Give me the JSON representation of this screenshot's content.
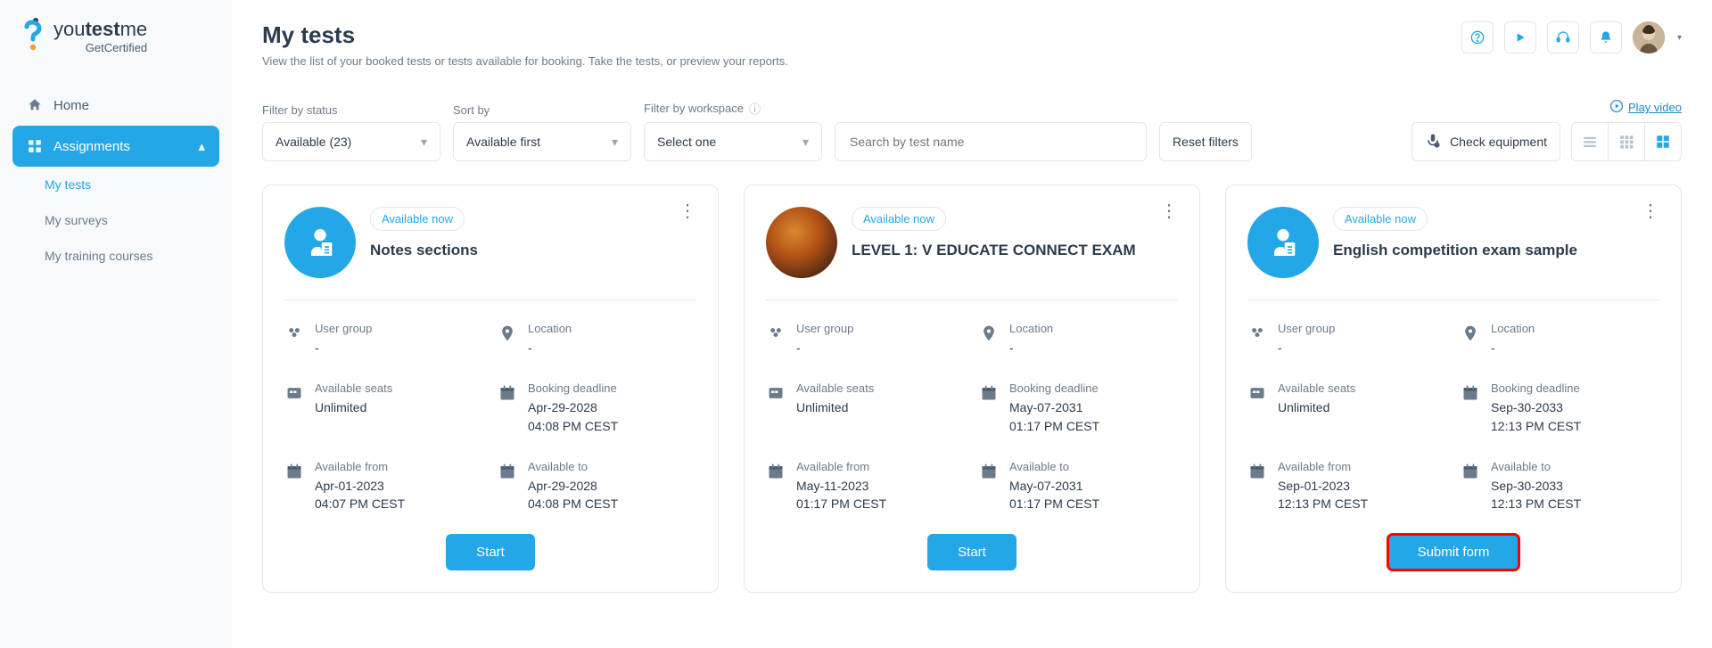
{
  "logo": {
    "brand_pre": "you",
    "brand_mid": "test",
    "brand_post": "me",
    "sub": "GetCertified"
  },
  "nav": {
    "home": "Home",
    "assignments": "Assignments",
    "my_tests": "My tests",
    "my_surveys": "My surveys",
    "my_training": "My training courses"
  },
  "page": {
    "title": "My tests",
    "subtitle": "View the list of your booked tests or tests available for booking. Take the tests, or preview your reports."
  },
  "filters": {
    "status_label": "Filter by status",
    "status_value": "Available (23)",
    "sort_label": "Sort by",
    "sort_value": "Available first",
    "workspace_label": "Filter by workspace",
    "workspace_value": "Select one",
    "search_placeholder": "Search by test name",
    "reset": "Reset filters",
    "play_video": "Play video",
    "check_equipment": "Check equipment"
  },
  "field_labels": {
    "user_group": "User group",
    "location": "Location",
    "available_seats": "Available seats",
    "booking_deadline": "Booking deadline",
    "available_from": "Available from",
    "available_to": "Available to"
  },
  "cards": [
    {
      "badge": "Available now",
      "title": "Notes sections",
      "user_group": "-",
      "location": "-",
      "seats": "Unlimited",
      "deadline_date": "Apr-29-2028",
      "deadline_time": "04:08 PM CEST",
      "from_date": "Apr-01-2023",
      "from_time": "04:07 PM CEST",
      "to_date": "Apr-29-2028",
      "to_time": "04:08 PM CEST",
      "cta": "Start",
      "highlighted": false,
      "icon": "default"
    },
    {
      "badge": "Available now",
      "title": "LEVEL 1: V EDUCATE CONNECT EXAM",
      "user_group": "-",
      "location": "-",
      "seats": "Unlimited",
      "deadline_date": "May-07-2031",
      "deadline_time": "01:17 PM CEST",
      "from_date": "May-11-2023",
      "from_time": "01:17 PM CEST",
      "to_date": "May-07-2031",
      "to_time": "01:17 PM CEST",
      "cta": "Start",
      "highlighted": false,
      "icon": "image"
    },
    {
      "badge": "Available now",
      "title": "English competition exam sample",
      "user_group": "-",
      "location": "-",
      "seats": "Unlimited",
      "deadline_date": "Sep-30-2033",
      "deadline_time": "12:13 PM CEST",
      "from_date": "Sep-01-2023",
      "from_time": "12:13 PM CEST",
      "to_date": "Sep-30-2033",
      "to_time": "12:13 PM CEST",
      "cta": "Submit form",
      "highlighted": true,
      "icon": "default"
    }
  ]
}
